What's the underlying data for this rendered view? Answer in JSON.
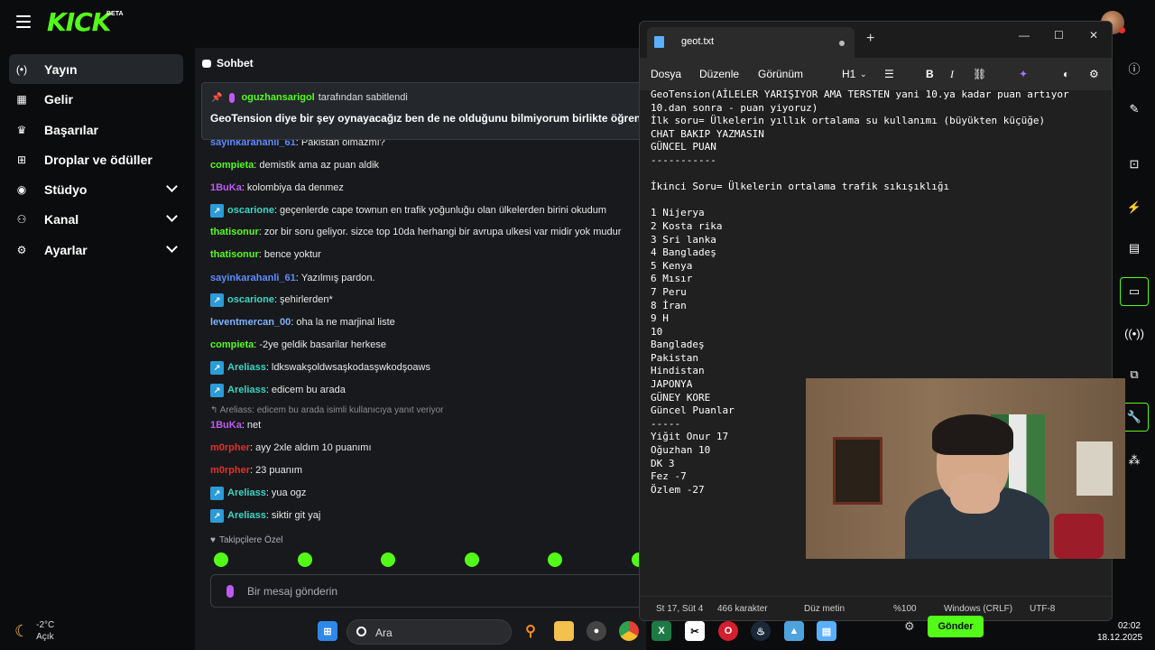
{
  "header": {
    "logo": "KICK",
    "logo_badge": "BETA"
  },
  "sidebar": {
    "items": [
      {
        "label": "Yayın",
        "icon": "broadcast-icon",
        "glyph": "(•)"
      },
      {
        "label": "Gelir",
        "icon": "revenue-icon",
        "glyph": "▦"
      },
      {
        "label": "Başarılar",
        "icon": "trophy-icon",
        "glyph": "♛"
      },
      {
        "label": "Droplar ve ödüller",
        "icon": "gift-icon",
        "glyph": "⊞"
      },
      {
        "label": "Stüdyo",
        "icon": "studio-icon",
        "glyph": "◉"
      },
      {
        "label": "Kanal",
        "icon": "channel-icon",
        "glyph": "⚇"
      },
      {
        "label": "Ayarlar",
        "icon": "gear-icon",
        "glyph": "⚙"
      }
    ]
  },
  "weather": {
    "temp": "-2°C",
    "condition": "Açık"
  },
  "chat": {
    "title": "Sohbet",
    "pinned_by": "oguzhansarigol",
    "pinned_suffix": "tarafından sabitlendi",
    "pinned_message": "GeoTension diye bir şey oynayacağız ben de ne olduğunu bilmiyorum birlikte öğrenic",
    "messages": [
      {
        "user": "sayinkarahanli_61",
        "text": "Pakistan olmazmı?",
        "color": "#5b8cff",
        "badge": false
      },
      {
        "user": "compieta",
        "text": "demistik ama az puan aldik",
        "color": "#53fc18",
        "badge": false
      },
      {
        "user": "1BuKa",
        "text": "kolombiya da denmez",
        "color": "#bf5af2",
        "badge": false
      },
      {
        "user": "oscarione",
        "text": "geçenlerde cape townun en trafik yoğunluğu olan ülkelerden birini okudum",
        "color": "#3ad6c6",
        "badge": true
      },
      {
        "user": "thatisonur",
        "text": "zor bir soru geliyor. sizce top 10da herhangi bir avrupa ulkesi var midir yok mudur",
        "color": "#53fc18",
        "badge": false
      },
      {
        "user": "thatisonur",
        "text": "bence yoktur",
        "color": "#53fc18",
        "badge": false
      },
      {
        "user": "sayinkarahanli_61",
        "text": "Yazılmış pardon.",
        "color": "#5b8cff",
        "badge": false
      },
      {
        "user": "oscarione",
        "text": "şehirlerden*",
        "color": "#3ad6c6",
        "badge": true
      },
      {
        "user": "leventmercan_00",
        "text": "oha la ne marjinal liste",
        "color": "#7fb2ff",
        "badge": false
      },
      {
        "user": "compieta",
        "text": "-2ye geldik basarilar herkese",
        "color": "#53fc18",
        "badge": false
      },
      {
        "user": "Areliass",
        "text": "ldkswakşoldwsaşkodasşwkodşoaws",
        "color": "#3ad6c6",
        "badge": true
      },
      {
        "user": "Areliass",
        "text": "edicem bu arada",
        "color": "#3ad6c6",
        "badge": true
      },
      {
        "user": "1BuKa",
        "text": "net",
        "color": "#bf5af2",
        "badge": false
      },
      {
        "user": "m0rpher",
        "text": "ayy 2xle aldım 10 puanımı",
        "color": "#e3312b",
        "badge": false
      },
      {
        "user": "m0rpher",
        "text": "23 puanım",
        "color": "#e3312b",
        "badge": false
      },
      {
        "user": "Areliass",
        "text": "yua ogz",
        "color": "#3ad6c6",
        "badge": true
      },
      {
        "user": "Areliass",
        "text": "siktir git yaj",
        "color": "#3ad6c6",
        "badge": true
      }
    ],
    "reply_note": "↰ Areliass: edicem bu arada isimli kullanıcıya yanıt veriyor",
    "followers_label": "Takipçilere Özel",
    "input_placeholder": "Bir mesaj gönderin",
    "send_label": "Gönder"
  },
  "notepad": {
    "tab_title": "geot.txt",
    "menu": [
      "Dosya",
      "Düzenle",
      "Görünüm"
    ],
    "heading_select": "H1",
    "content": "GeoTension(AİLELER YARIŞIYOR AMA TERSTEN yani 10.ya kadar puan artıyor\n10.dan sonra - puan yiyoruz)\nİlk soru= Ülkelerin yıllık ortalama su kullanımı (büyükten küçüğe)\nCHAT BAKIP YAZMASIN\nGÜNCEL PUAN\n-----------\n\nİkinci Soru= Ülkelerin ortalama trafik sıkışıklığı\n\n1 Nijerya\n2 Kosta rika\n3 Sri lanka\n4 Bangladeş\n5 Kenya\n6 Mısır\n7 Peru\n8 İran\n9 H\n10\nBangladeş\nPakistan\nHindistan\nJAPONYA\nGÜNEY KORE\nGüncel Puanlar\n-----\nYiğit Onur 17\nOğuzhan 10\nDK 3\nFez -7\nÖzlem -27",
    "status": {
      "position": "St 17, Süt 4",
      "chars": "466 karakter",
      "format": "Düz metin",
      "zoom": "%100",
      "eol": "Windows (CRLF)",
      "encoding": "UTF-8"
    }
  },
  "taskbar": {
    "search_placeholder": "Ara",
    "time": "02:02",
    "date": "18.12.2025"
  }
}
